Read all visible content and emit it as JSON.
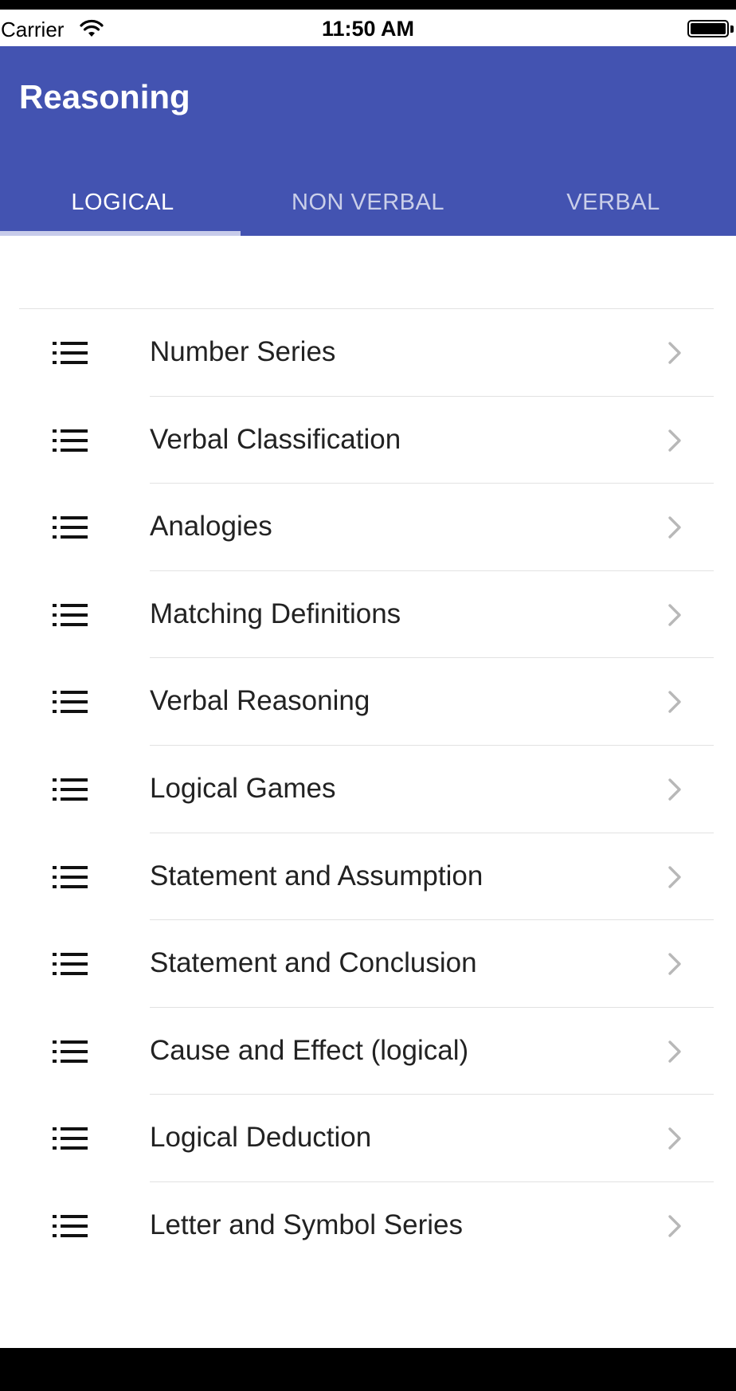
{
  "status_bar": {
    "carrier": "Carrier",
    "time": "11:50 AM"
  },
  "header": {
    "title": "Reasoning",
    "background_color": "#4353b1"
  },
  "tabs": [
    {
      "label": "LOGICAL",
      "active": true
    },
    {
      "label": "NON VERBAL",
      "active": false
    },
    {
      "label": "VERBAL",
      "active": false
    }
  ],
  "list": {
    "icon": "list-icon",
    "trailing_icon": "chevron-right-icon",
    "items": [
      {
        "label": "Number Series"
      },
      {
        "label": "Verbal Classification"
      },
      {
        "label": "Analogies"
      },
      {
        "label": "Matching Definitions"
      },
      {
        "label": "Verbal Reasoning"
      },
      {
        "label": "Logical Games"
      },
      {
        "label": "Statement and Assumption"
      },
      {
        "label": "Statement and Conclusion"
      },
      {
        "label": "Cause and Effect (logical)"
      },
      {
        "label": "Logical Deduction"
      },
      {
        "label": "Letter and Symbol Series"
      }
    ]
  }
}
